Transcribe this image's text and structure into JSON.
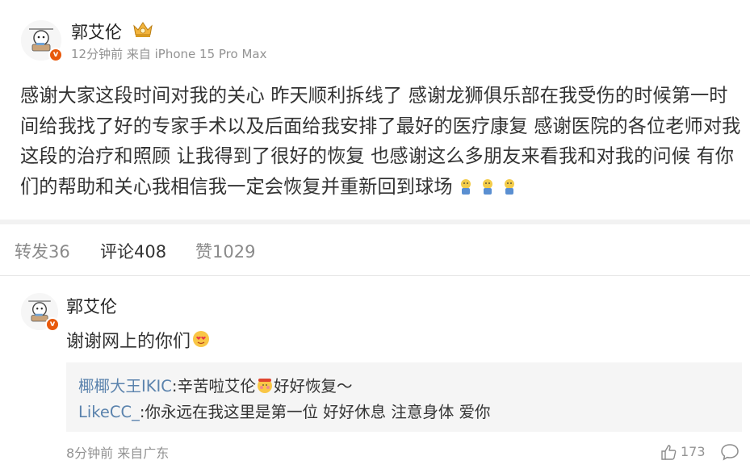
{
  "post": {
    "author": "郭艾伦",
    "meta": "12分钟前 来自 iPhone 15 Pro Max",
    "text": "感谢大家这段时间对我的关心 昨天顺利拆线了 感谢龙狮俱乐部在我受伤的时候第一时间给我找了好的专家手术以及后面给我安排了最好的医疗康复 感谢医院的各位老师对我这段的治疗和照顾 让我得到了很好的恢复 也感谢这么多朋友来看我和对我的问候 有你们的帮助和关心我相信我一定会恢复并重新回到球场",
    "trailing_emoji_icons": [
      "face-emoji-icon",
      "face-emoji-icon",
      "face-emoji-icon"
    ]
  },
  "tabs": [
    {
      "label": "转发36"
    },
    {
      "label": "评论408"
    },
    {
      "label": "赞1029"
    }
  ],
  "comment": {
    "author": "郭艾伦",
    "text": "谢谢网上的你们",
    "replies": [
      {
        "user": "椰椰大王IKIC",
        "sep": ":",
        "text_before": "辛苦啦艾伦",
        "text_after": "好好恢复～"
      },
      {
        "user": "LikeCC_",
        "sep": ":",
        "text": "你永远在我这里是第一位 好好休息 注意身体 爱你"
      }
    ],
    "meta": "8分钟前 来自广东",
    "likes": "173"
  },
  "colors": {
    "verified_badge": "#e8590c",
    "reply_user_link": "#5b83ad",
    "meta_gray": "#939393",
    "reply_bg": "#f5f5f5"
  }
}
